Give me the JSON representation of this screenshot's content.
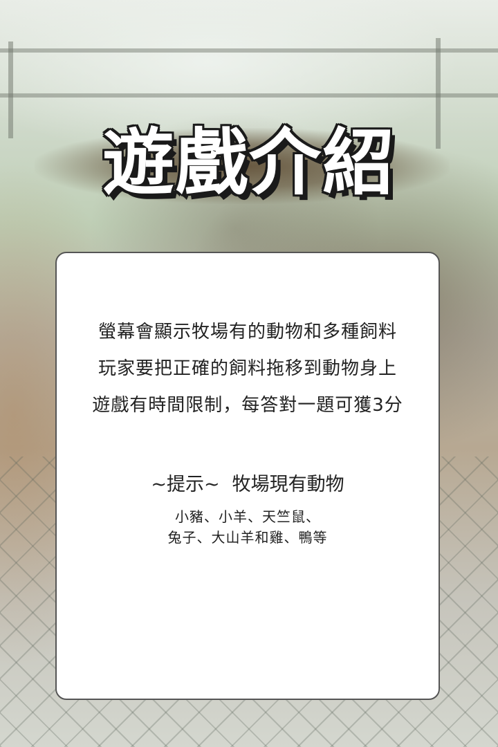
{
  "title": "遊戲介紹",
  "description": {
    "line1": "螢幕會顯示牧場有的動物和多種飼料",
    "line2": "玩家要把正確的飼料拖移到動物身上",
    "line3": "遊戲有時間限制，每答對一題可獲3分"
  },
  "hint": {
    "label": "~提示~",
    "heading": "牧場現有動物",
    "animals_line1": "小豬、小羊、天竺鼠、",
    "animals_line2": "兔子、大山羊和雞、鴨等"
  }
}
